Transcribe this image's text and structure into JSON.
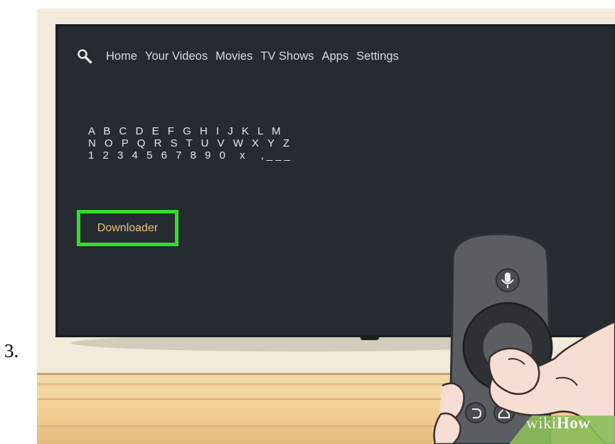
{
  "step": {
    "number": "3."
  },
  "nav": {
    "items": [
      {
        "label": "Home"
      },
      {
        "label": "Your Videos"
      },
      {
        "label": "Movies"
      },
      {
        "label": "TV Shows"
      },
      {
        "label": "Apps"
      },
      {
        "label": "Settings"
      }
    ]
  },
  "keyboard": {
    "rows": [
      [
        "A",
        "B",
        "C",
        "D",
        "E",
        "F",
        "G",
        "H",
        "I",
        "J",
        "K",
        "L",
        "M"
      ],
      [
        "N",
        "O",
        "P",
        "Q",
        "R",
        "S",
        "T",
        "U",
        "V",
        "W",
        "X",
        "Y",
        "Z"
      ],
      [
        "1",
        "2",
        "3",
        "4",
        "5",
        "6",
        "7",
        "8",
        "9",
        "0",
        "x",
        ",___"
      ]
    ]
  },
  "search_result": {
    "label": "Downloader"
  },
  "watermark": {
    "part1": "wiki",
    "part2": "How"
  },
  "colors": {
    "screen": "#252b30",
    "highlight": "#33dd2a",
    "result_text": "#e9c37d",
    "wall": "#f2ebdb",
    "table": "#f1cc91"
  },
  "icons": {
    "search": "search-icon",
    "mic": "microphone-icon",
    "back": "back-icon",
    "home": "home-icon"
  }
}
